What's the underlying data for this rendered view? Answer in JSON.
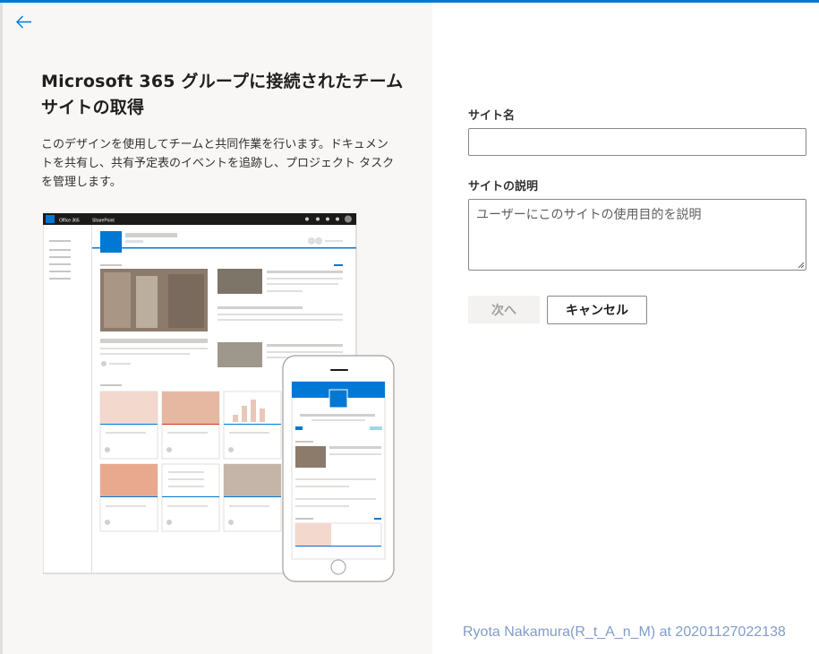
{
  "left_panel": {
    "title": "Microsoft 365 グループに接続されたチーム サイトの取得",
    "description": "このデザインを使用してチームと共同作業を行います。ドキュメントを共有し、共有予定表のイベントを追跡し、プロジェクト タスクを管理します。",
    "illustration": {
      "browser_brand": "Office 365",
      "browser_app": "SharePoint"
    }
  },
  "form": {
    "site_name_label": "サイト名",
    "site_name_value": "",
    "site_description_label": "サイトの説明",
    "site_description_placeholder": "ユーザーにこのサイトの使用目的を説明",
    "next_button": "次へ",
    "cancel_button": "キャンセル"
  },
  "watermark": "Ryota Nakamura(R_t_A_n_M) at 20201127022138",
  "colors": {
    "accent": "#0078d4",
    "left_panel_bg": "#f8f7f6"
  },
  "icons": {
    "back": "arrow-left-icon"
  }
}
